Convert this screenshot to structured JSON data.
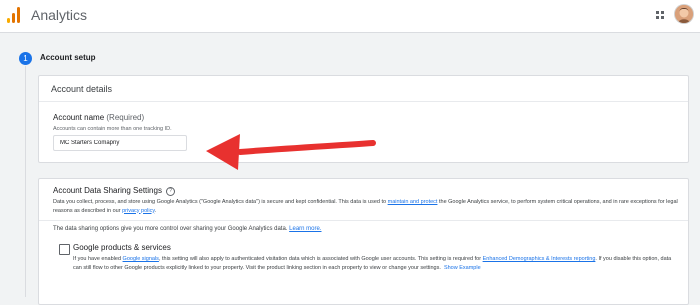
{
  "header": {
    "app_title": "Analytics",
    "logo_colors": [
      "#f9ab00",
      "#e37400",
      "#e37400"
    ]
  },
  "step": {
    "number": "1",
    "title": "Account setup",
    "accent_color": "#1a73e8"
  },
  "account_details": {
    "title": "Account details",
    "name_label": "Account name",
    "name_required": "(Required)",
    "name_hint": "Accounts can contain more than one tracking ID.",
    "name_value": "MC Starters Comapny"
  },
  "annotation": {
    "arrow_color": "#e8312f"
  },
  "sharing": {
    "title": "Account Data Sharing Settings",
    "desc_part1": "Data you collect, process, and store using Google Analytics (\"Google Analytics data\") is secure and kept confidential. This data is used to ",
    "desc_link1": "maintain and protect",
    "desc_part2": " the Google Analytics service, to perform system critical operations, and in rare exceptions for legal reasons as described in our ",
    "desc_link2": "privacy policy",
    "desc_part3": ".",
    "intro_text": "The data sharing options give you more control over sharing your Google Analytics data. ",
    "learn_more": "Learn more.",
    "option": {
      "label": "Google products & services",
      "checked": false,
      "desc_part1": "If you have enabled ",
      "desc_link1": "Google signals",
      "desc_part2": ", this setting will also apply to authenticated visitation data which is associated with Google user accounts. This setting is required for ",
      "desc_link2": "Enhanced Demographics & Interests reporting",
      "desc_part3": ". If you disable this option, data can still flow to other Google products explicitly linked to your property. Visit the product linking section in each property to view or change your settings.",
      "show_example": "Show Example"
    }
  }
}
